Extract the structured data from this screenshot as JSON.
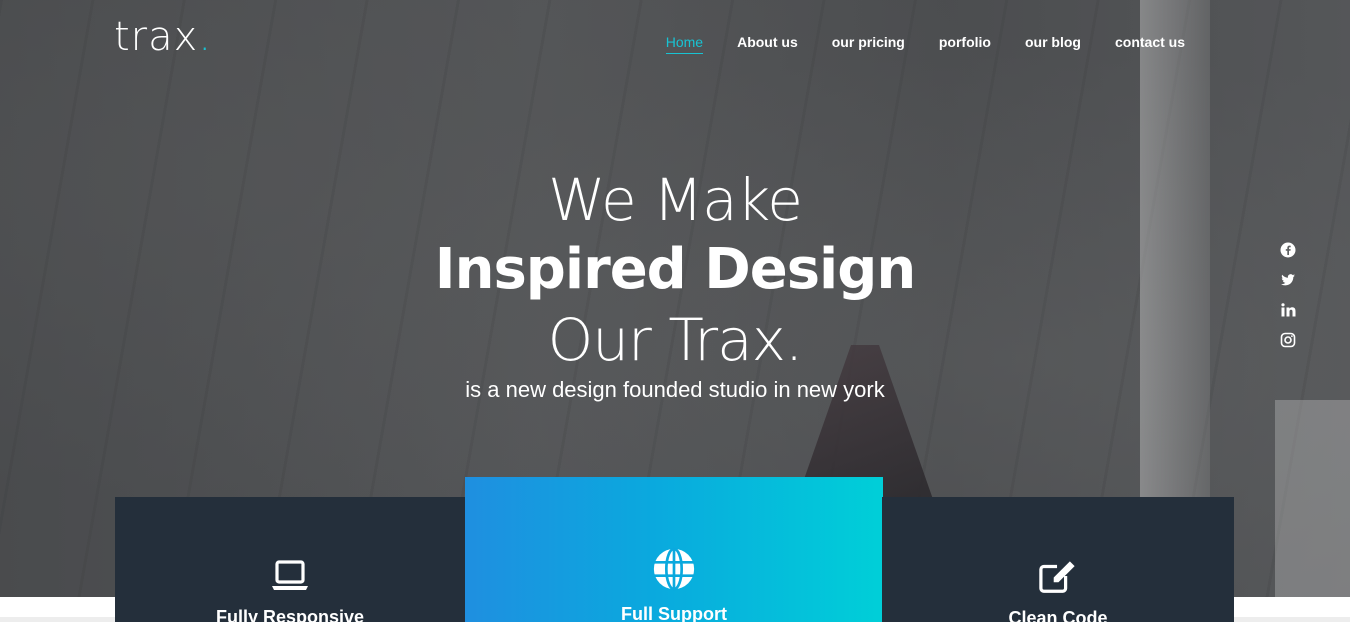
{
  "brand": {
    "name": "trax",
    "dot": "."
  },
  "nav": {
    "items": [
      {
        "label": "Home",
        "active": true
      },
      {
        "label": "About us"
      },
      {
        "label": "our pricing"
      },
      {
        "label": "porfolio"
      },
      {
        "label": "our blog"
      },
      {
        "label": "contact us"
      }
    ]
  },
  "hero": {
    "line1": "We Make",
    "line2": "Inspired Design",
    "line3": "Our Trax.",
    "subtitle": "is a new design founded studio in new york"
  },
  "social": [
    "facebook-icon",
    "twitter-icon",
    "linkedin-icon",
    "instagram-icon"
  ],
  "features": [
    {
      "icon": "laptop-icon",
      "title": "Fully Responsive"
    },
    {
      "icon": "globe-icon",
      "title": "Full Support"
    },
    {
      "icon": "edit-icon",
      "title": "Clean Code"
    }
  ],
  "colors": {
    "accent": "#18c3d3",
    "card_dark": "#242f3b",
    "gradient_start": "#1f8fe0",
    "gradient_end": "#00cfd8"
  }
}
